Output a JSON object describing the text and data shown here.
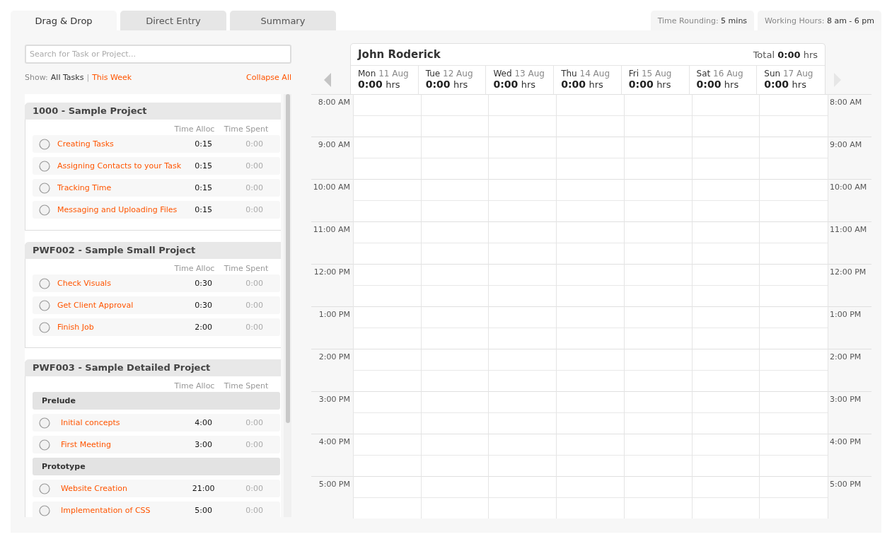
{
  "tabs": [
    {
      "label": "Drag & Drop",
      "selected": true
    },
    {
      "label": "Direct Entry",
      "selected": false
    },
    {
      "label": "Summary",
      "selected": false
    }
  ],
  "settings": [
    {
      "label": "Time Rounding:",
      "value": "5 mins"
    },
    {
      "label": "Working Hours:",
      "value": "8 am - 6 pm"
    }
  ],
  "search": {
    "placeholder": "Search for Task or Project..."
  },
  "filter": {
    "label": "Show:",
    "separator": "|",
    "options": [
      {
        "label": "All Tasks",
        "selected": true
      },
      {
        "label": "This Week",
        "selected": false
      }
    ],
    "collapse": "Collapse All"
  },
  "projects": [
    {
      "title": "1000 - Sample Project",
      "columns": [
        "Time Alloc",
        "Time Spent"
      ],
      "items": [
        {
          "kind": "task",
          "name": "Creating Tasks",
          "alloc": "0:15",
          "spent": "0:00"
        },
        {
          "kind": "task",
          "name": "Assigning Contacts to your Task",
          "alloc": "0:15",
          "spent": "0:00"
        },
        {
          "kind": "task",
          "name": "Tracking Time",
          "alloc": "0:15",
          "spent": "0:00"
        },
        {
          "kind": "task",
          "name": "Messaging and Uploading Files",
          "alloc": "0:15",
          "spent": "0:00"
        }
      ]
    },
    {
      "title": "PWF002 - Sample Small Project",
      "columns": [
        "Time Alloc",
        "Time Spent"
      ],
      "items": [
        {
          "kind": "task",
          "name": "Check Visuals",
          "alloc": "0:30",
          "spent": "0:00"
        },
        {
          "kind": "task",
          "name": "Get Client Approval",
          "alloc": "0:30",
          "spent": "0:00"
        },
        {
          "kind": "task",
          "name": "Finish Job",
          "alloc": "2:00",
          "spent": "0:00"
        }
      ]
    },
    {
      "title": "PWF003 - Sample Detailed Project",
      "columns": [
        "Time Alloc",
        "Time Spent"
      ],
      "items": [
        {
          "kind": "group",
          "name": "Prelude"
        },
        {
          "kind": "subtask",
          "name": "Initial concepts",
          "alloc": "4:00",
          "spent": "0:00"
        },
        {
          "kind": "subtask",
          "name": "First Meeting",
          "alloc": "3:00",
          "spent": "0:00"
        },
        {
          "kind": "group",
          "name": "Prototype"
        },
        {
          "kind": "subtask",
          "name": "Website Creation",
          "alloc": "21:00",
          "spent": "0:00"
        },
        {
          "kind": "subtask",
          "name": "Implementation of CSS",
          "alloc": "5:00",
          "spent": "0:00"
        }
      ]
    }
  ],
  "calendar": {
    "person": "John Roderick",
    "total_label": "Total",
    "total_value": "0:00",
    "total_unit": "hrs",
    "days": [
      {
        "day": "Mon",
        "date": "11 Aug",
        "hours": "0:00",
        "unit": "hrs"
      },
      {
        "day": "Tue",
        "date": "12 Aug",
        "hours": "0:00",
        "unit": "hrs"
      },
      {
        "day": "Wed",
        "date": "13 Aug",
        "hours": "0:00",
        "unit": "hrs"
      },
      {
        "day": "Thu",
        "date": "14 Aug",
        "hours": "0:00",
        "unit": "hrs"
      },
      {
        "day": "Fri",
        "date": "15 Aug",
        "hours": "0:00",
        "unit": "hrs"
      },
      {
        "day": "Sat",
        "date": "16 Aug",
        "hours": "0:00",
        "unit": "hrs"
      },
      {
        "day": "Sun",
        "date": "17 Aug",
        "hours": "0:00",
        "unit": "hrs"
      }
    ],
    "slots": [
      {
        "left": "8:00 AM",
        "right": "8:00 AM"
      },
      {
        "left": "9:00 AM",
        "right": "9:00 AM"
      },
      {
        "left": "10:00 AM",
        "right": "10:00 AM"
      },
      {
        "left": "11:00 AM",
        "right": "11:00 AM"
      },
      {
        "left": "12:00 PM",
        "right": "12:00 PM"
      },
      {
        "left": "1:00 PM",
        "right": "1:00 PM"
      },
      {
        "left": "2:00 PM",
        "right": "2:00 PM"
      },
      {
        "left": "3:00 PM",
        "right": "3:00 PM"
      },
      {
        "left": "4:00 PM",
        "right": "4:00 PM"
      },
      {
        "left": "5:00 PM",
        "right": "5:00 PM"
      }
    ]
  }
}
